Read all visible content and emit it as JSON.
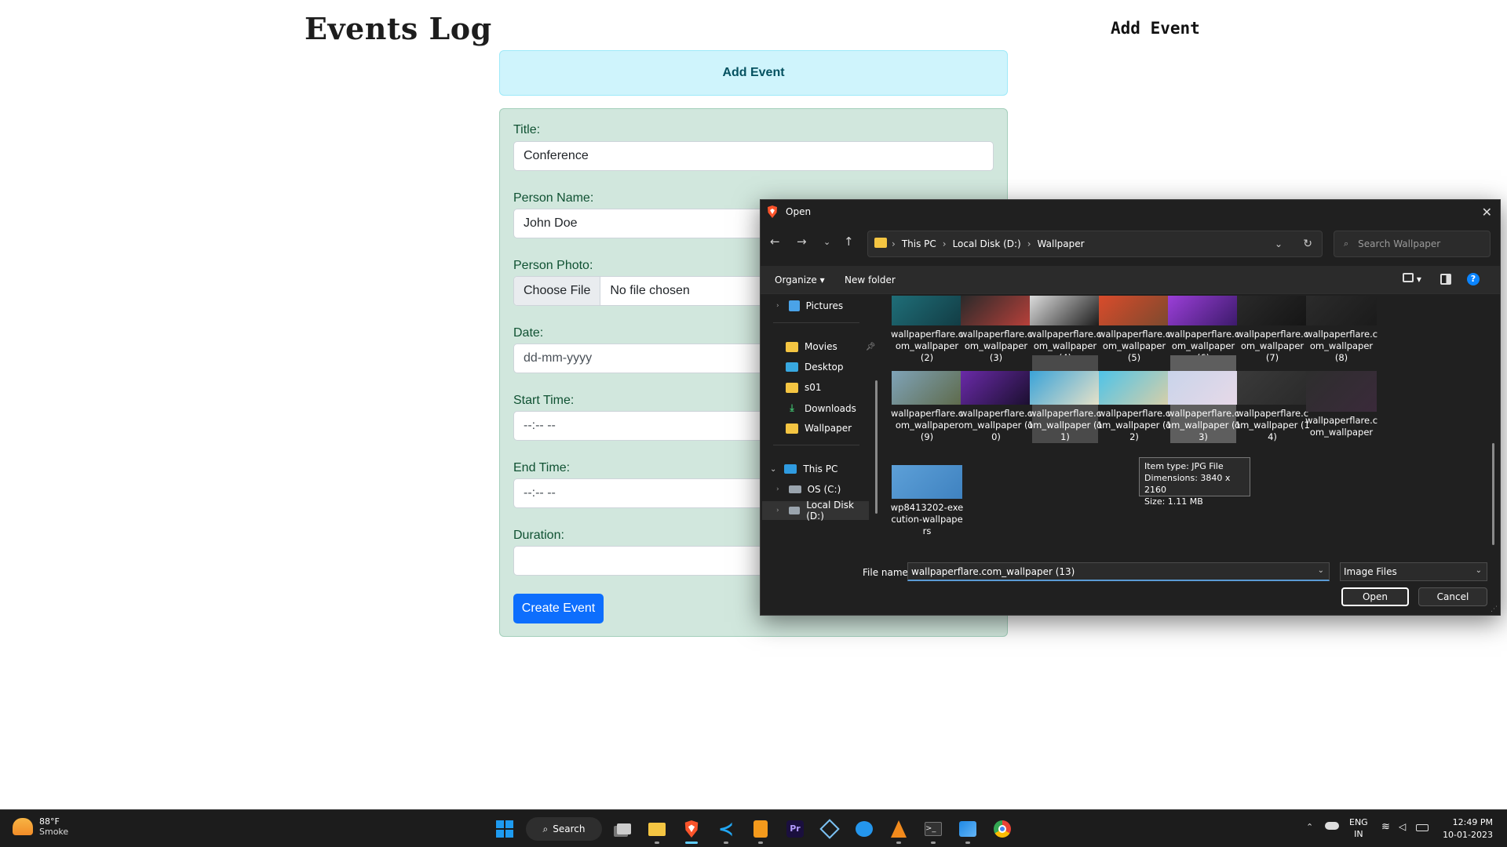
{
  "page": {
    "title": "Events Log",
    "nav_link": "Add Event",
    "card_header": "Add Event",
    "form": {
      "title_label": "Title:",
      "title_value": "Conference",
      "person_label": "Person Name:",
      "person_value": "John Doe",
      "photo_label": "Person Photo:",
      "choose_file": "Choose File",
      "no_file": "No file chosen",
      "date_label": "Date:",
      "date_placeholder": "dd-mm-yyyy",
      "start_label": "Start Time:",
      "start_placeholder": "--:-- --",
      "end_label": "End Time:",
      "end_placeholder": "--:-- --",
      "duration_label": "Duration:",
      "duration_value": "",
      "submit": "Create Event"
    },
    "colors": {
      "card_header_bg": "#cff4fc",
      "form_bg": "#d1e7dd",
      "primary": "#0d6efd"
    }
  },
  "dialog": {
    "title": "Open",
    "close_icon": "close-icon",
    "breadcrumb": [
      "This PC",
      "Local Disk (D:)",
      "Wallpaper"
    ],
    "search_placeholder": "Search Wallpaper",
    "toolbar": {
      "organize": "Organize",
      "new_folder": "New folder"
    },
    "nav_items": [
      {
        "label": "Pictures",
        "icon": "pictures-icon"
      },
      {
        "label": "Movies",
        "icon": "folder-icon"
      },
      {
        "label": "Desktop",
        "icon": "desktop-icon"
      },
      {
        "label": "s01",
        "icon": "folder-icon"
      },
      {
        "label": "Downloads",
        "icon": "download-icon"
      },
      {
        "label": "Wallpaper",
        "icon": "folder-icon"
      },
      {
        "label": "This PC",
        "icon": "computer-icon"
      },
      {
        "label": "OS (C:)",
        "icon": "drive-icon"
      },
      {
        "label": "Local Disk (D:)",
        "icon": "drive-icon"
      }
    ],
    "files_row1": [
      {
        "name": "wallpaperflare.com_wallpaper (2)",
        "c1": "#1f6e78",
        "c2": "#123c44"
      },
      {
        "name": "wallpaperflare.com_wallpaper (3)",
        "c1": "#2a2a2a",
        "c2": "#b8403a"
      },
      {
        "name": "wallpaperflare.com_wallpaper (4)",
        "c1": "#dcdcdc",
        "c2": "#1a1a1a"
      },
      {
        "name": "wallpaperflare.com_wallpaper (5)",
        "c1": "#d94b2b",
        "c2": "#7c4a2e"
      },
      {
        "name": "wallpaperflare.com_wallpaper (6)",
        "c1": "#9b3fd8",
        "c2": "#3b1a6a"
      },
      {
        "name": "wallpaperflare.com_wallpaper (7)",
        "c1": "#2a2a2a",
        "c2": "#151515"
      },
      {
        "name": "wallpaperflare.com_wallpaper (8)",
        "c1": "#2b2b2b",
        "c2": "#1b1b1b"
      }
    ],
    "files_row2": [
      {
        "name": "wallpaperflare.com_wallpaper (9)",
        "c1": "#7fa3b8",
        "c2": "#5e6a4a"
      },
      {
        "name": "wallpaperflare.com_wallpaper (10)",
        "c1": "#6a2aa8",
        "c2": "#1a0f2e"
      },
      {
        "name": "wallpaperflare.com_wallpaper (11)",
        "c1": "#3aa3d8",
        "c2": "#e8e2c8"
      },
      {
        "name": "wallpaperflare.com_wallpaper (12)",
        "c1": "#4ec3e8",
        "c2": "#d8cfa8"
      },
      {
        "name": "wallpaperflare.com_wallpaper (13)",
        "c1": "#c9d4ea",
        "c2": "#e7d9e8"
      },
      {
        "name": "wallpaperflare.com_wallpaper (14)",
        "c1": "#3a3a3a",
        "c2": "#2a2a2a"
      },
      {
        "name": "wallpaperflare.com_wallpaper",
        "c1": "#2e2e2e",
        "c2": "#3a2a3a"
      }
    ],
    "files_row3": [
      {
        "name": "wp8413202-execution-wallpapers",
        "c1": "#5da0d8",
        "c2": "#3f82c0"
      }
    ],
    "tooltip": {
      "type": "Item type: JPG File",
      "dimensions": "Dimensions: 3840 x 2160",
      "size": "Size: 1.11 MB"
    },
    "file_name_label": "File name:",
    "file_name_value": "wallpaperflare.com_wallpaper (13)",
    "file_type": "Image Files",
    "open_button": "Open",
    "cancel_button": "Cancel"
  },
  "taskbar": {
    "weather_temp": "88°F",
    "weather_desc": "Smoke",
    "search_label": "Search",
    "lang1": "ENG",
    "lang2": "IN",
    "time": "12:49 PM",
    "date": "10-01-2023"
  }
}
